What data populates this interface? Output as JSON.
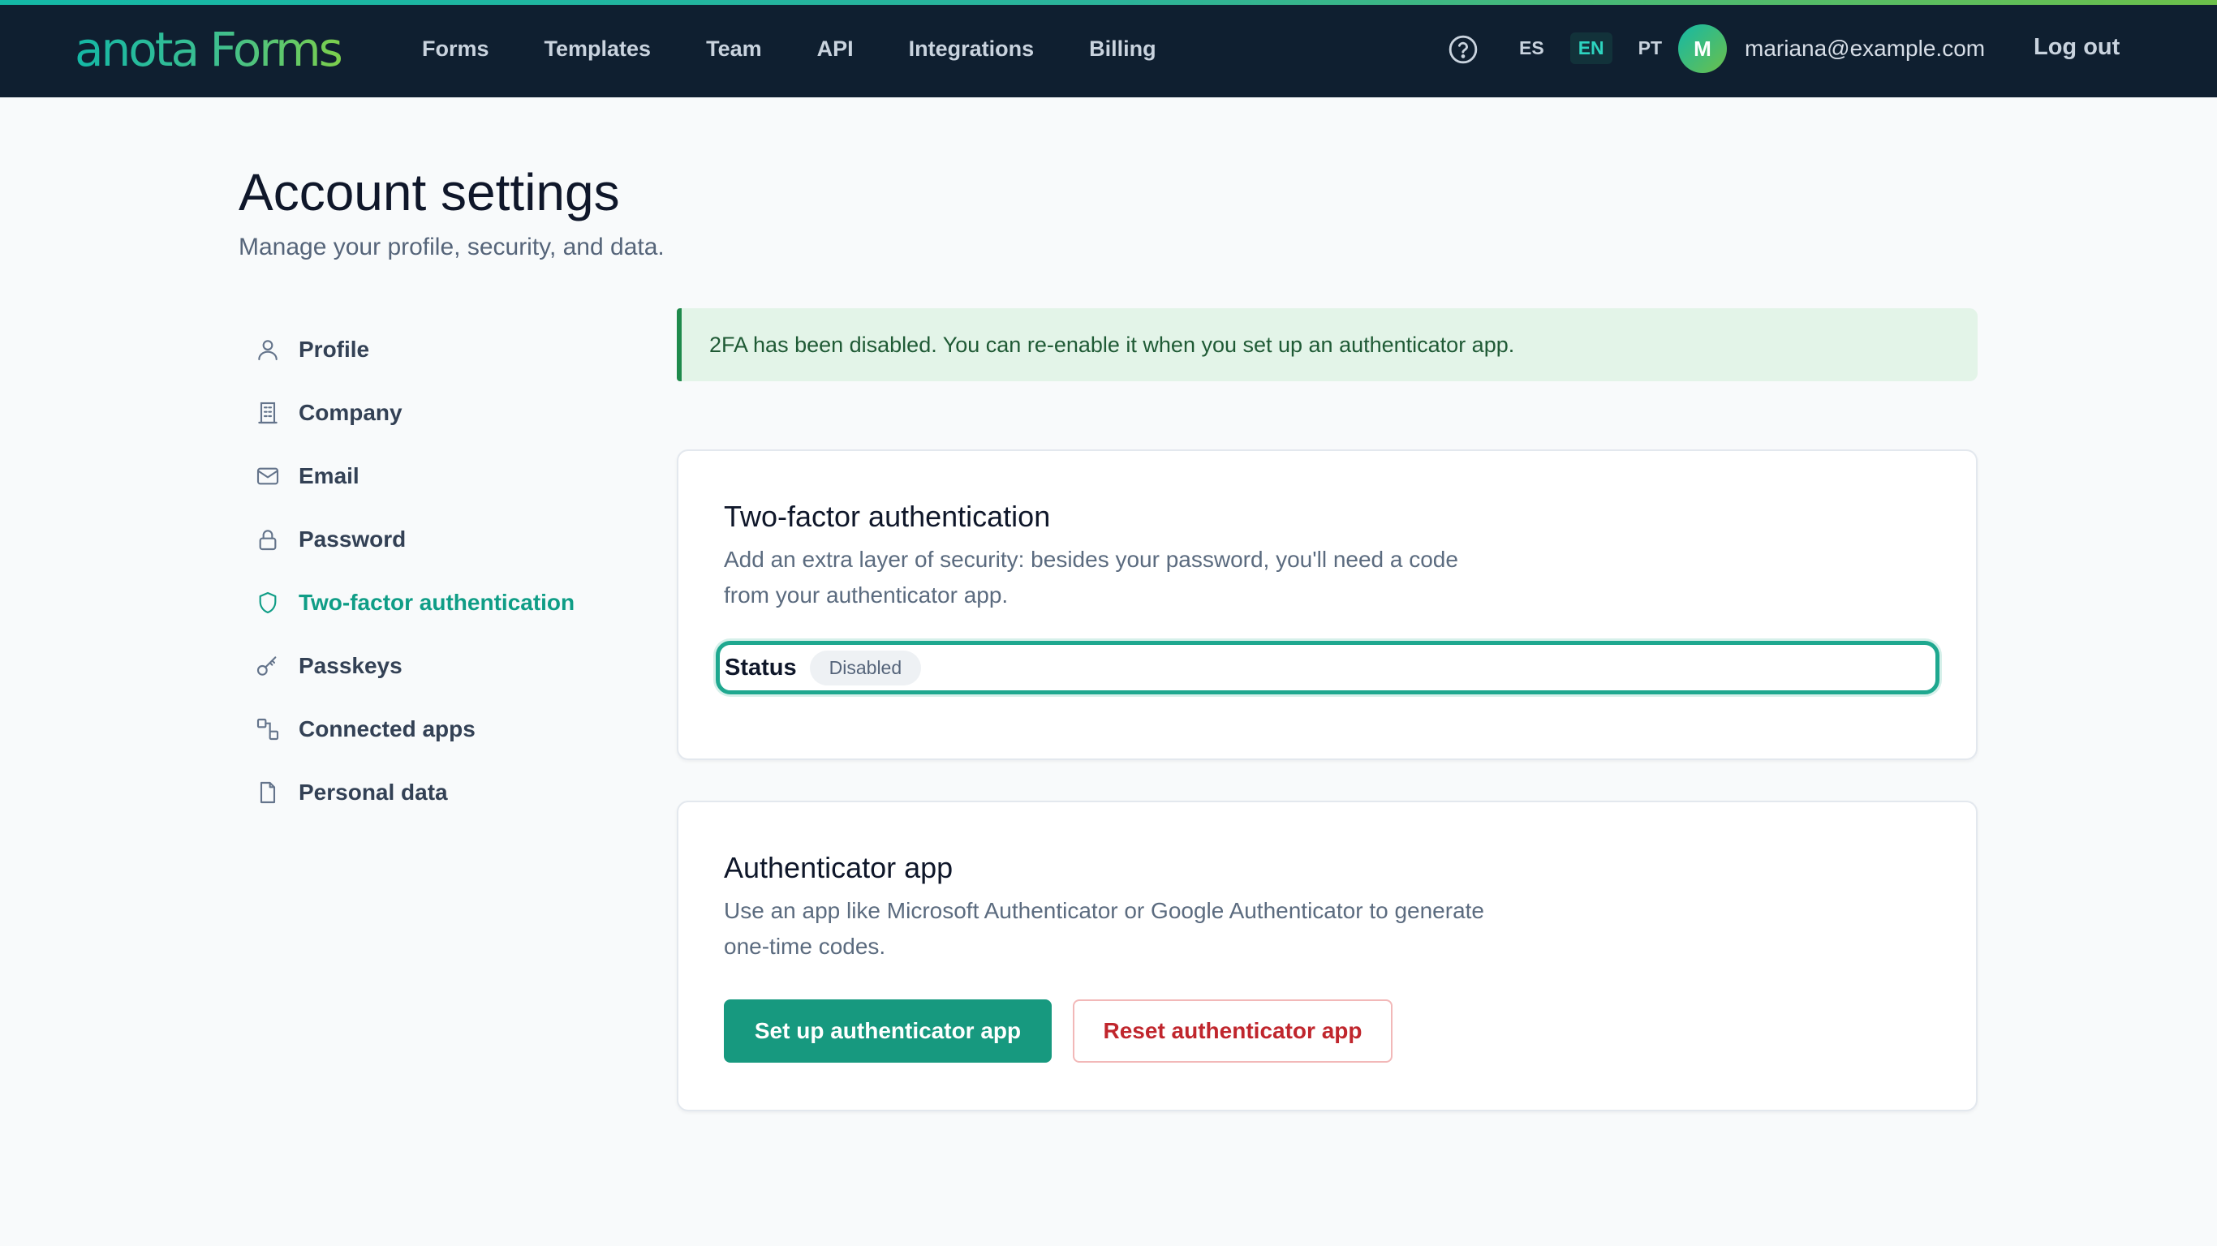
{
  "header": {
    "logo": "anota Forms",
    "nav": [
      "Forms",
      "Templates",
      "Team",
      "API",
      "Integrations",
      "Billing"
    ],
    "help_icon": "question-circle-icon",
    "languages": [
      {
        "code": "ES",
        "active": false
      },
      {
        "code": "EN",
        "active": true
      },
      {
        "code": "PT",
        "active": false
      }
    ],
    "avatar_initial": "M",
    "user_email": "mariana@example.com",
    "logout_label": "Log out",
    "colors": {
      "background": "#0f1f30",
      "accent": "#14b8a6",
      "accent_alt": "#6cc04a"
    }
  },
  "page": {
    "title": "Account settings",
    "subtitle": "Manage your profile, security, and data."
  },
  "sidebar": {
    "items": [
      {
        "label": "Profile",
        "icon": "user-icon",
        "active": false
      },
      {
        "label": "Company",
        "icon": "building-icon",
        "active": false
      },
      {
        "label": "Email",
        "icon": "envelope-icon",
        "active": false
      },
      {
        "label": "Password",
        "icon": "lock-icon",
        "active": false
      },
      {
        "label": "Two-factor authentication",
        "icon": "shield-icon",
        "active": true
      },
      {
        "label": "Passkeys",
        "icon": "key-icon",
        "active": false
      },
      {
        "label": "Connected apps",
        "icon": "connected-apps-icon",
        "active": false
      },
      {
        "label": "Personal data",
        "icon": "document-icon",
        "active": false
      }
    ]
  },
  "alert": {
    "type": "success",
    "text": "2FA has been disabled. You can re-enable it when you set up an authenticator app."
  },
  "two_factor": {
    "title": "Two-factor authentication",
    "description": "Add an extra layer of security: besides your password, you'll need a code from your authenticator app.",
    "status_label": "Status",
    "status_value": "Disabled"
  },
  "authenticator": {
    "title": "Authenticator app",
    "description": "Use an app like Microsoft Authenticator or Google Authenticator to generate one-time codes.",
    "setup_label": "Set up authenticator app",
    "reset_label": "Reset authenticator app"
  },
  "colors": {
    "primary": "#17997f",
    "danger": "#c0262d",
    "success_bg": "#e3f4e8",
    "success_border": "#1f8a4c"
  }
}
